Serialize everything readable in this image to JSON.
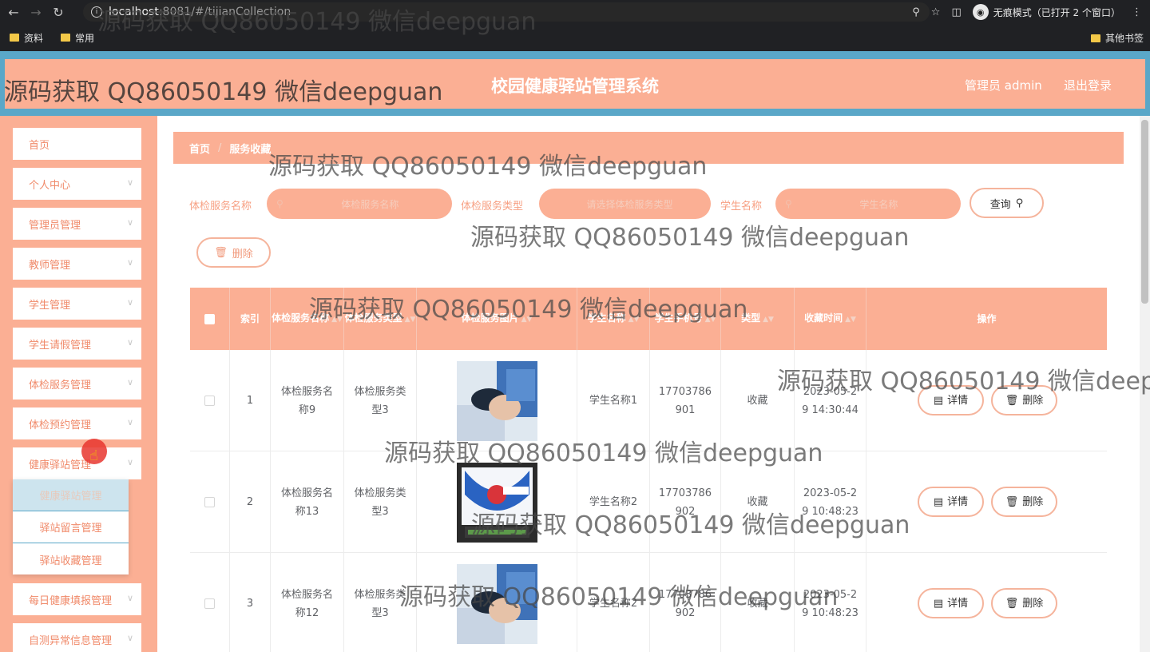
{
  "browser": {
    "url_host": "localhost",
    "url_path": ":8081/#/tijianCollection",
    "incognito_label": "无痕模式（已打开 2 个窗口）",
    "bookmarks": [
      "资料",
      "常用"
    ],
    "other_bookmarks": "其他书签"
  },
  "header": {
    "title": "校园健康驿站管理系统",
    "admin": "管理员 admin",
    "logout": "退出登录"
  },
  "sidebar": {
    "items": [
      "首页",
      "个人中心",
      "管理员管理",
      "教师管理",
      "学生管理",
      "学生请假管理",
      "体检服务管理",
      "体检预约管理",
      "健康驿站管理",
      "每日健康填报管理",
      "自测异常信息管理"
    ],
    "submenu": [
      "健康驿站管理",
      "驿站留言管理",
      "驿站收藏管理"
    ]
  },
  "breadcrumb": {
    "home": "首页",
    "current": "服务收藏"
  },
  "search": {
    "name_label": "体检服务名称",
    "name_placeholder": "体检服务名称",
    "type_label": "体检服务类型",
    "type_placeholder": "请选择体检服务类型",
    "student_label": "学生名称",
    "student_placeholder": "学生名称",
    "query_button": "查询",
    "delete_button": "删除"
  },
  "table": {
    "headers": [
      "索引",
      "体检服务名称",
      "体检服务类型",
      "体检服务图片",
      "学生名称",
      "学生手机号",
      "类型",
      "收藏时间",
      "操作"
    ],
    "rows": [
      {
        "index": "1",
        "name": "体检服务名称9",
        "type": "体检服务类型3",
        "student": "学生名称1",
        "phone": "17703786901",
        "kind": "收藏",
        "time": "2023-05-29 14:30:44"
      },
      {
        "index": "2",
        "name": "体检服务名称13",
        "type": "体检服务类型3",
        "student": "学生名称2",
        "phone": "17703786902",
        "kind": "收藏",
        "time": "2023-05-29 10:48:23"
      },
      {
        "index": "3",
        "name": "体检服务名称12",
        "type": "体检服务类型3",
        "student": "学生名称2",
        "phone": "17703786902",
        "kind": "收藏",
        "time": "2023-05-29 10:48:23"
      }
    ],
    "detail_button": "详情",
    "delete_button": "删除"
  },
  "watermark": "源码获取 QQ86050149 微信deepguan"
}
